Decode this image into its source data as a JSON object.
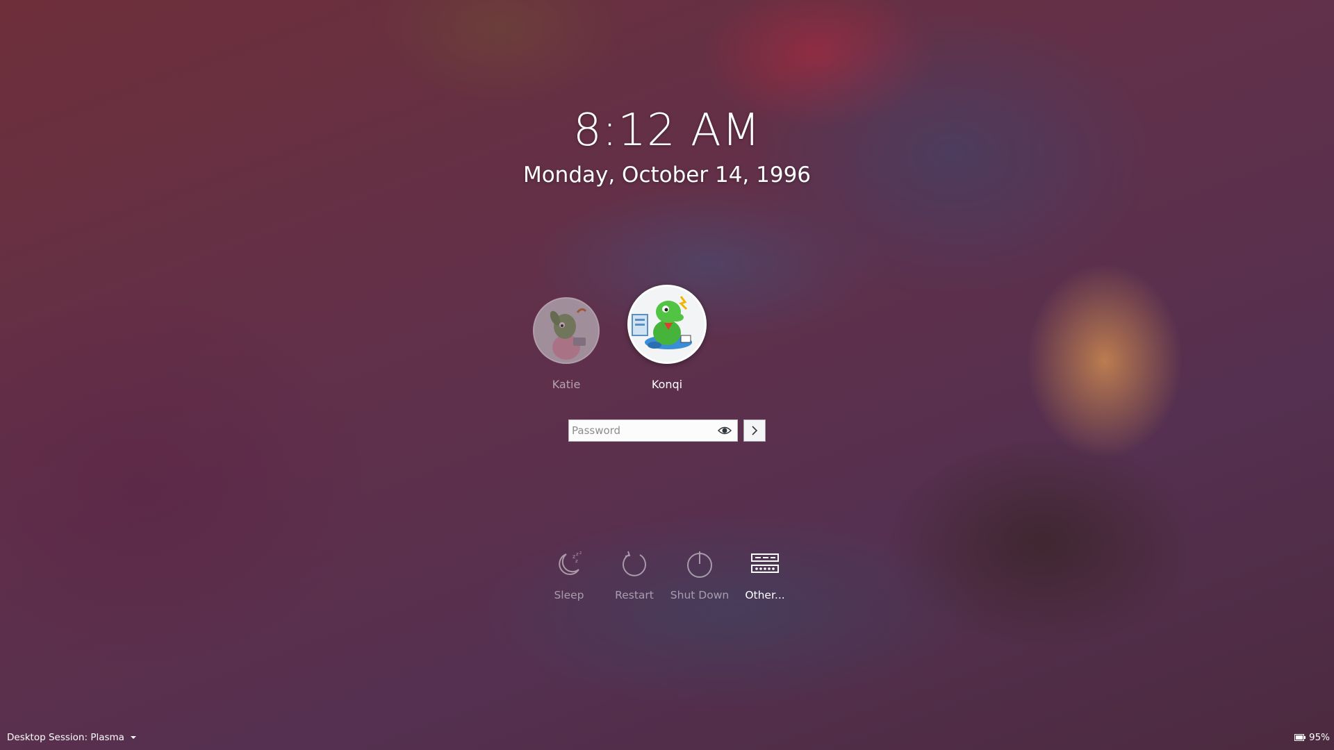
{
  "clock": {
    "time": "8:12 AM",
    "date": "Monday, October 14, 1996"
  },
  "users": [
    {
      "name": "Katie",
      "selected": false
    },
    {
      "name": "Konqi",
      "selected": true
    }
  ],
  "login": {
    "password_placeholder": "Password",
    "password_value": ""
  },
  "actions": [
    {
      "label": "Sleep",
      "icon": "sleep-icon"
    },
    {
      "label": "Restart",
      "icon": "restart-icon"
    },
    {
      "label": "Shut Down",
      "icon": "shutdown-icon"
    },
    {
      "label": "Other...",
      "icon": "other-icon"
    }
  ],
  "session": {
    "label": "Desktop Session: Plasma"
  },
  "battery": {
    "percent": "95%"
  },
  "colors": {
    "text": "#ffffff",
    "field_bg": "#fcfcfc"
  }
}
